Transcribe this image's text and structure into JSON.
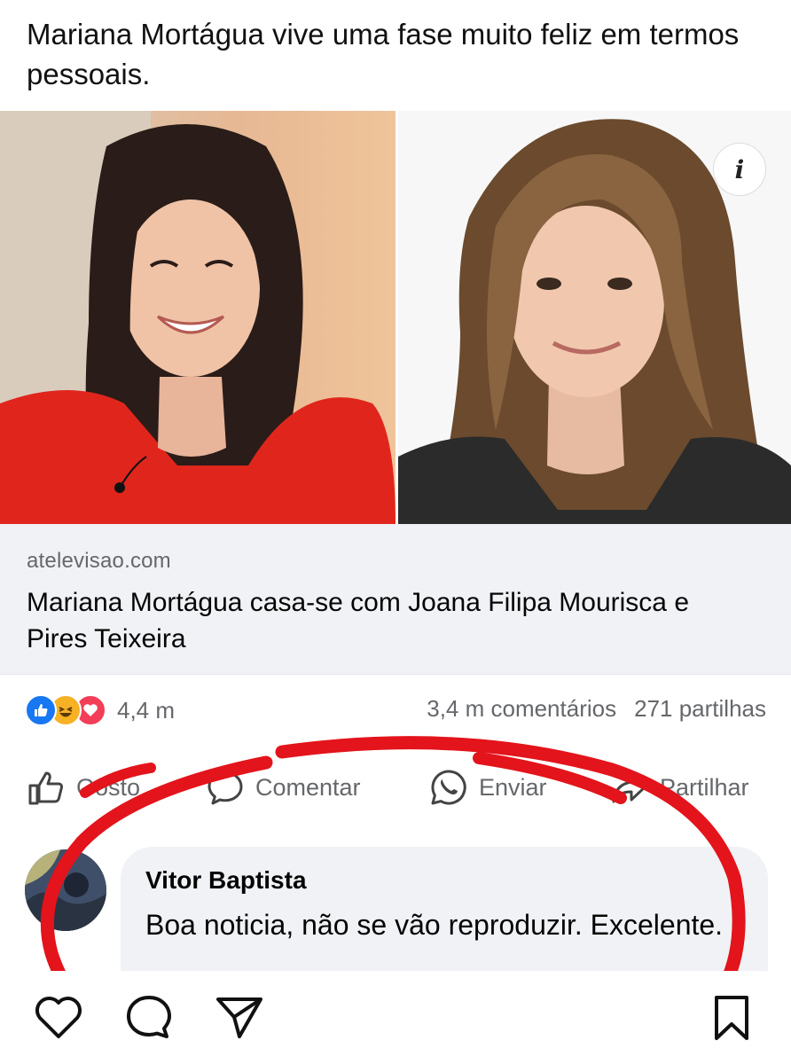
{
  "post": {
    "text": "Mariana Mortágua vive uma fase muito feliz em termos pessoais."
  },
  "photos": {
    "left_alt": "woman in red top smiling",
    "right_alt": "woman with long light-brown hair smiling",
    "info_glyph": "i"
  },
  "link": {
    "domain": "atelevisao.com",
    "title": "Mariana Mortágua casa-se com Joana Filipa Mourisca e Pires Teixeira"
  },
  "stats": {
    "reactions_count": "4,4 m",
    "comments": "3,4 m comentários",
    "shares": "271 partilhas",
    "reaction_icons": [
      "like-icon",
      "haha-icon",
      "love-icon"
    ]
  },
  "actions": {
    "like_label": "Gosto",
    "comment_label": "Comentar",
    "send_label": "Enviar",
    "share_label": "Partilhar"
  },
  "comment": {
    "author": "Vitor Baptista",
    "text": "Boa noticia, não se vão reproduzir. Excelente."
  },
  "colors": {
    "facebook_blue": "#1877f2",
    "love_red": "#f33e58",
    "haha_yellow": "#f7b125",
    "annotation_red": "#e3141b",
    "muted_text": "#65676b"
  }
}
